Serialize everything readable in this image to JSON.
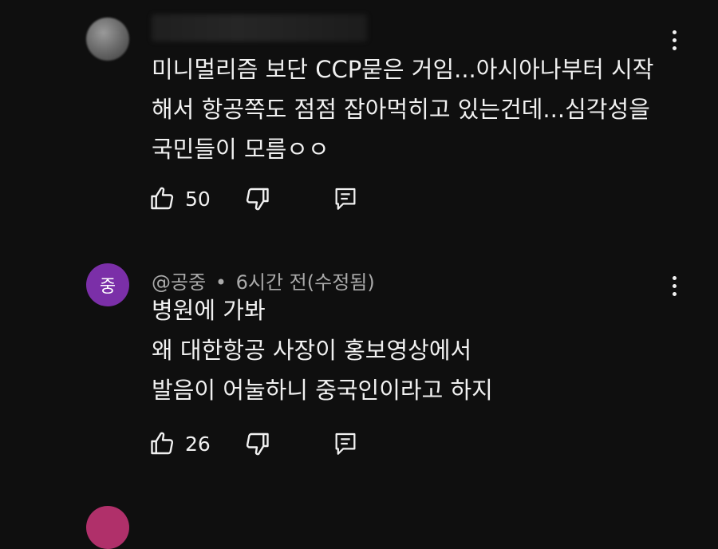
{
  "comments": [
    {
      "author": "",
      "avatar_letter": "",
      "body_lines": [
        "미니멀리즘 보단 CCP묻은 거임...아시아나부터 시작",
        "해서 항공쪽도 점점 잡아먹히고 있는건데...심각성을",
        "국민들이 모름ㅇㅇ"
      ],
      "likes": "50"
    },
    {
      "author": "@공중",
      "separator": "•",
      "timestamp": "6시간 전(수정됨)",
      "avatar_letter": "중",
      "body_lines": [
        "병원에 가봐",
        "왜 대한항공 사장이 홍보영상에서",
        "발음이 어눌하니 중국인이라고 하지"
      ],
      "likes": "26"
    }
  ],
  "icons": {
    "like": "thumbs-up-icon",
    "dislike": "thumbs-down-icon",
    "reply": "reply-comment-icon",
    "menu": "more-vert-icon"
  },
  "colors": {
    "background": "#0f0f0f",
    "text": "#f1f1f1",
    "meta": "#aaaaaa",
    "avatar_purple": "#7b2fa8"
  }
}
